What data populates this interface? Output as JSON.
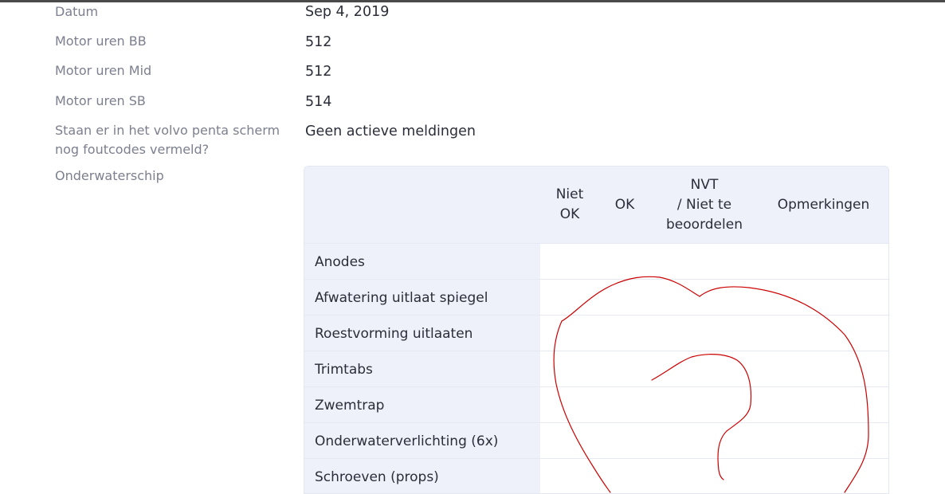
{
  "fields": {
    "datum_label": "Datum",
    "datum_value": "Sep 4, 2019",
    "bb_label": "Motor uren BB",
    "bb_value": "512",
    "mid_label": "Motor uren Mid",
    "mid_value": "512",
    "sb_label": "Motor uren SB",
    "sb_value": "514",
    "foutcodes_label_line1": "Staan er in het volvo penta scherm",
    "foutcodes_label_line2": "nog foutcodes vermeld?",
    "foutcodes_value": "Geen actieve meldingen",
    "onderwaterschip_label": "Onderwaterschip"
  },
  "table": {
    "headers": {
      "niet_ok_line1": "Niet",
      "niet_ok_line2": "OK",
      "ok": "OK",
      "nvt_line1": "NVT",
      "nvt_line2": "/ Niet te",
      "nvt_line3": "beoordelen",
      "opmerkingen": "Opmerkingen"
    },
    "rows": [
      "Anodes",
      "Afwatering uitlaat spiegel",
      "Roestvorming uitlaaten",
      "Trimtabs",
      "Zwemtrap",
      "Onderwaterverlichting (6x)",
      "Schroeven (props)"
    ]
  },
  "colors": {
    "label_gray": "#7c7f8e",
    "text_dark": "#2b2d38",
    "table_header_bg": "#eef0fa",
    "annotation_red": "#cc0000"
  }
}
